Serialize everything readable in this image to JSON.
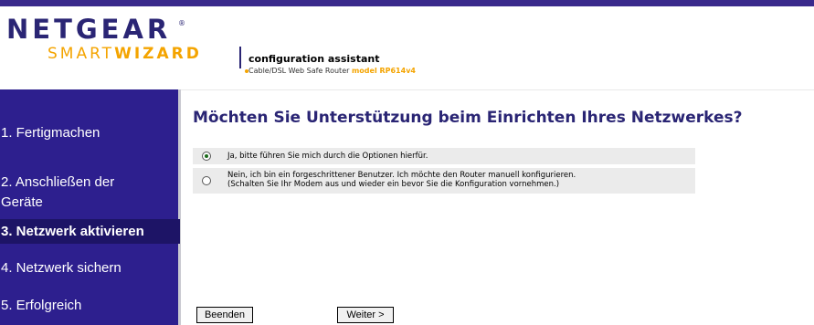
{
  "header": {
    "brand": "NETGEAR",
    "reg_mark": "®",
    "product_light": "SMART",
    "product_bold": "WIZARD",
    "tagline": "configuration assistant",
    "subtitle": "Cable/DSL Web Safe Router",
    "model": "model RP614v4"
  },
  "sidebar": {
    "items": [
      {
        "label": "1. Fertigmachen",
        "active": false
      },
      {
        "label": "2. Anschließen der",
        "label2": "Geräte",
        "active": false
      },
      {
        "label": "3. Netzwerk aktivieren",
        "active": true
      },
      {
        "label": "4. Netzwerk sichern",
        "active": false
      },
      {
        "label": "5. Erfolgreich",
        "active": false
      }
    ]
  },
  "main": {
    "title": "Möchten Sie Unterstützung beim Einrichten Ihres Netzwerkes?",
    "options": [
      {
        "line1": "Ja, bitte führen Sie mich durch die Optionen hierfür.",
        "checked": true
      },
      {
        "line1": "Nein, ich bin ein forgeschrittener Benutzer. Ich möchte den Router manuell konfigurieren.",
        "line2": "(Schalten Sie Ihr Modem aus und wieder ein bevor Sie die Konfiguration vornehmen.)",
        "checked": false
      }
    ],
    "buttons": {
      "cancel": "Beenden",
      "next": "Weiter >"
    }
  },
  "colors": {
    "brand_navy": "#2a2574",
    "brand_orange": "#f4a400",
    "sidebar_bg": "#2d1f8e"
  }
}
